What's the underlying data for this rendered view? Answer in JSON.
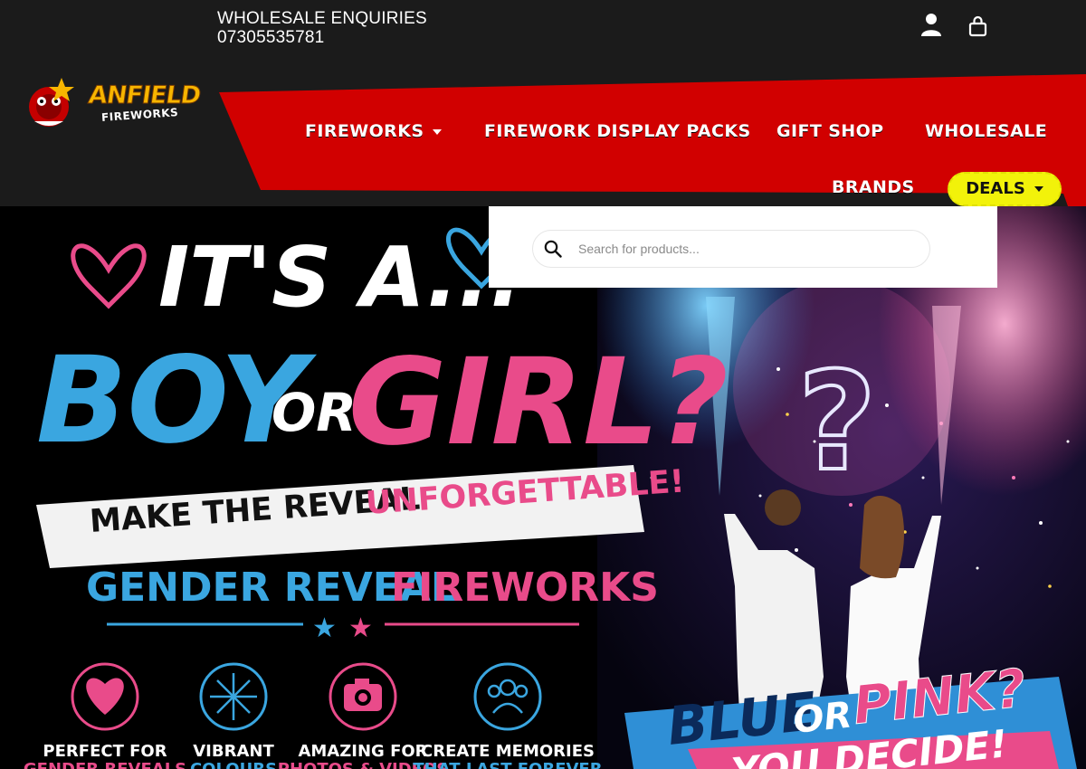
{
  "header": {
    "enquiries_label": "WHOLESALE ENQUIRIES",
    "enquiries_phone": "07305535781",
    "account_icon": "user-icon",
    "cart_icon": "shopping-bag-icon"
  },
  "logo": {
    "line1": "ANFIELD",
    "line2": "FIREWORKS"
  },
  "nav": {
    "items": [
      {
        "label": "FIREWORKS",
        "has_dropdown": true
      },
      {
        "label": "FIREWORK DISPLAY PACKS",
        "has_dropdown": false
      },
      {
        "label": "GIFT SHOP",
        "has_dropdown": false
      },
      {
        "label": "WHOLESALE",
        "has_dropdown": false
      },
      {
        "label": "BRANDS",
        "has_dropdown": false
      },
      {
        "label": "DEALS",
        "has_dropdown": true
      }
    ]
  },
  "search": {
    "placeholder": "Search for products..."
  },
  "hero": {
    "line1": "IT'S A...",
    "boy": "BOY",
    "or": "OR",
    "girl": "GIRL?",
    "banner_a": "MAKE THE REVEAL",
    "banner_b": "UNFORGETTABLE!",
    "subtitle_a": "GENDER REVEAL",
    "subtitle_b": "FIREWORKS",
    "features": [
      {
        "icon": "heart-icon",
        "line1": "PERFECT FOR",
        "line2": "GENDER REVEALS",
        "color": "#e94b8a"
      },
      {
        "icon": "sparkle-icon",
        "line1": "VIBRANT",
        "line2": "COLOURS",
        "color": "#3aa6e0"
      },
      {
        "icon": "camera-icon",
        "line1": "AMAZING FOR",
        "line2": "PHOTOS & VIDEOS",
        "color": "#e94b8a"
      },
      {
        "icon": "people-icon",
        "line1": "CREATE MEMORIES",
        "line2": "THAT LAST FOREVER",
        "color": "#3aa6e0"
      }
    ],
    "badge_a": "BLUE",
    "badge_or": "OR",
    "badge_b": "PINK?",
    "badge_c": "YOU DECIDE!"
  },
  "colors": {
    "nav_red": "#d10000",
    "header_dark": "#1b1b1b",
    "deals_yellow": "#f2f20a",
    "blue": "#3aa6e0",
    "pink": "#e94b8a"
  }
}
